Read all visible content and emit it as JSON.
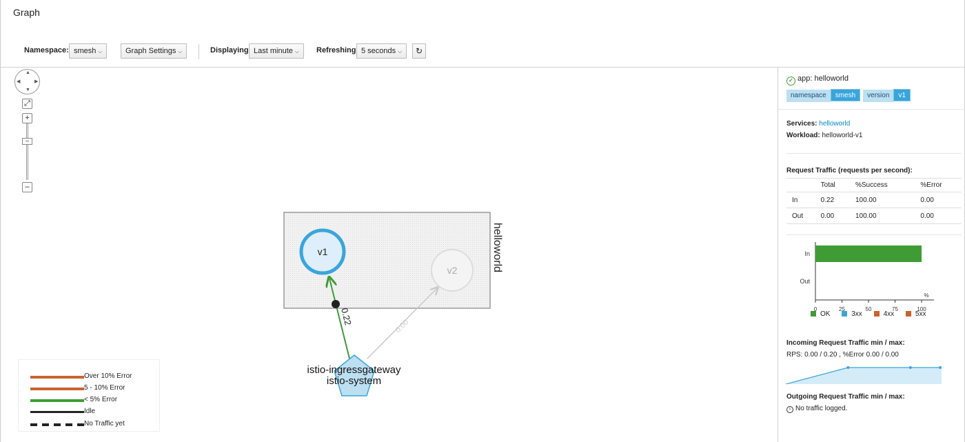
{
  "page": {
    "title": "Graph"
  },
  "toolbar": {
    "namespace_label": "Namespace:",
    "namespace_value": "smesh",
    "graph_settings": "Graph Settings",
    "displaying_label": "Displaying",
    "displaying_value": "Last minute",
    "refreshing_label": "Refreshing",
    "refreshing_value": "5 seconds",
    "refresh_icon": "refresh-icon"
  },
  "graph": {
    "app_box_label": "helloworld",
    "nodes": [
      {
        "id": "v1",
        "label": "v1",
        "shape": "circle",
        "state": "selected"
      },
      {
        "id": "v2",
        "label": "v2",
        "shape": "circle",
        "state": "idle"
      },
      {
        "id": "gateway",
        "label_line1": "istio-ingressgateway",
        "label_line2": "istio-system",
        "shape": "pentagon"
      }
    ],
    "edges": [
      {
        "from": "gateway",
        "to": "v1",
        "label": "0.22",
        "color": "#3f9c35"
      },
      {
        "from": "gateway",
        "to": "v2",
        "label": "0.00",
        "color": "#c8c8c8"
      }
    ]
  },
  "legend": [
    {
      "label": "Over 10% Error",
      "color": "#c9632e",
      "style": "solid"
    },
    {
      "label": "5 - 10% Error",
      "color": "#c9632e",
      "style": "solid"
    },
    {
      "label": "< 5% Error",
      "color": "#3f9c35",
      "style": "solid"
    },
    {
      "label": "Idle",
      "color": "#222222",
      "style": "solid"
    },
    {
      "label": "No Traffic yet",
      "color": "#222222",
      "style": "dashed"
    }
  ],
  "side_panel": {
    "app_title": "app: helloworld",
    "labels": [
      {
        "key": "namespace",
        "value": "smesh"
      },
      {
        "key": "version",
        "value": "v1"
      }
    ],
    "services_label": "Services:",
    "services_value": "helloworld",
    "workload_label": "Workload:",
    "workload_value": "helloworld-v1",
    "request_traffic_title": "Request Traffic (requests per second):",
    "table_headers": [
      "",
      "Total",
      "%Success",
      "%Error"
    ],
    "table_rows": [
      [
        "In",
        "0.22",
        "100.00",
        "0.00"
      ],
      [
        "Out",
        "0.00",
        "100.00",
        "0.00"
      ]
    ],
    "incoming_title": "Incoming Request Traffic min / max:",
    "incoming_stats": "RPS: 0.00 / 0.20 , %Error 0.00 / 0.00",
    "outgoing_title": "Outgoing Request Traffic min / max:",
    "outgoing_stats": "No traffic logged."
  },
  "chart_data": [
    {
      "type": "bar",
      "orientation": "horizontal",
      "categories": [
        "In",
        "Out"
      ],
      "series": [
        {
          "name": "OK",
          "color": "#3f9c35",
          "values": [
            100,
            0
          ]
        },
        {
          "name": "3xx",
          "color": "#39a5dc",
          "values": [
            0,
            0
          ]
        },
        {
          "name": "4xx",
          "color": "#c9632e",
          "values": [
            0,
            0
          ]
        },
        {
          "name": "5xx",
          "color": "#c9632e",
          "values": [
            0,
            0
          ]
        }
      ],
      "xlim": [
        0,
        100
      ],
      "xticks": [
        "0",
        "25",
        "50",
        "75",
        "100"
      ],
      "unit_label": "%"
    },
    {
      "type": "area",
      "x": [
        0,
        1,
        2,
        3,
        4,
        5
      ],
      "values": [
        0.0,
        0.1,
        0.2,
        0.2,
        0.2,
        0.2
      ],
      "ylim": [
        0,
        0.25
      ],
      "color": "#39a5dc"
    }
  ]
}
